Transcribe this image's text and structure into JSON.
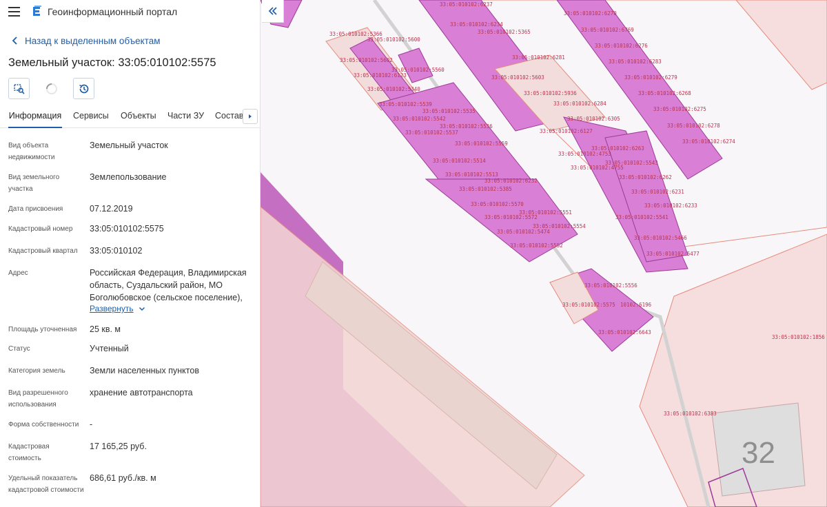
{
  "app": {
    "title": "Геоинформационный портал"
  },
  "navigation": {
    "back_label": "Назад к выделенным объектам"
  },
  "object": {
    "title": "Земельный участок: 33:05:010102:5575"
  },
  "tabs": [
    {
      "label": "Информация",
      "active": true
    },
    {
      "label": "Сервисы"
    },
    {
      "label": "Объекты"
    },
    {
      "label": "Части ЗУ"
    },
    {
      "label": "Состав"
    }
  ],
  "properties": [
    {
      "label": "Вид объекта недвижимости",
      "value": "Земельный участок"
    },
    {
      "label": "Вид земельного участка",
      "value": "Землепользование"
    },
    {
      "label": "Дата присвоения",
      "value": "07.12.2019"
    },
    {
      "label": "Кадастровый номер",
      "value": "33:05:010102:5575"
    },
    {
      "label": "Кадастровый квартал",
      "value": "33:05:010102"
    },
    {
      "label": "Адрес",
      "value": "Российская Федерация, Владимирская область, Суздальский район, МО Боголюбовское (сельское поселение),",
      "expand_label": "Развернуть"
    },
    {
      "label": "Площадь уточненная",
      "value": "25 кв. м"
    },
    {
      "label": "Статус",
      "value": "Учтенный"
    },
    {
      "label": "Категория земель",
      "value": "Земли населенных пунктов"
    },
    {
      "label": "Вид разрешенного использования",
      "value": "хранение автотранспорта"
    },
    {
      "label": "Форма собственности",
      "value": "-"
    },
    {
      "label": "Кадастровая стоимость",
      "value": "17 165,25 руб."
    },
    {
      "label": "Удельный показатель кадастровой стоимости",
      "value": "686,61 руб./кв. м"
    }
  ],
  "map": {
    "colors": {
      "parcel_fill": "#d97fd6",
      "parcel_stroke": "#9d3a98",
      "zone_fill": "#f3dcdc",
      "zone_stroke": "#e58a7b",
      "big_zone": "#c46fc1"
    },
    "parcel_labels": [
      "33:05:010102:5366",
      "33:05:010102:5600",
      "33:05:010102:5602",
      "33:05:010102:6123",
      "33:05:010102:5560",
      "33:05:010102:5340",
      "33:05:010102:5539",
      "33:05:010102:5535",
      "33:05:010102:5542",
      "33:05:010102:5536",
      "33:05:010102:5537",
      "33:05:010102:5559",
      "33:05:010102:5514",
      "33:05:010102:5513",
      "33:05:010102:6232",
      "33:05:010102:5385",
      "33:05:010102:5570",
      "33:05:010102:5551",
      "33:05:010102:5572",
      "33:05:010102:5554",
      "33:05:010102:5474",
      "33:05:010102:5552",
      "33:05:010102:6237",
      "33:05:010102:6234",
      "33:05:010102:5365",
      "33:05:010102:6281",
      "33:05:010102:5603",
      "33:05:010102:5936",
      "33:05:010102:6284",
      "33:05:010102:6305",
      "33:05:010102:6127",
      "33:05:010102:6270",
      "33:05:010102:6769",
      "33:05:010102:6276",
      "33:05:010102:6283",
      "33:05:010102:6279",
      "33:05:010102:6268",
      "33:05:010102:6275",
      "33:05:010102:6278",
      "33:05:010102:6274",
      "33:05:010102:6263",
      "33:05:010102:4753",
      "33:05:010102:5543",
      "33:05:010102:4755",
      "33:05:010102:6262",
      "33:05:010102:6231",
      "33:05:010102:6233",
      "33:05:010102:5541",
      "33:05:010102:5466",
      "33:05:010102:5477",
      "33:05:010102:5556",
      "33:05:010102:5575",
      "10102:6196",
      "33:05:010102:6643",
      "33:05:010102:1856",
      "33:05:010102:6383"
    ],
    "building_number": "32"
  }
}
